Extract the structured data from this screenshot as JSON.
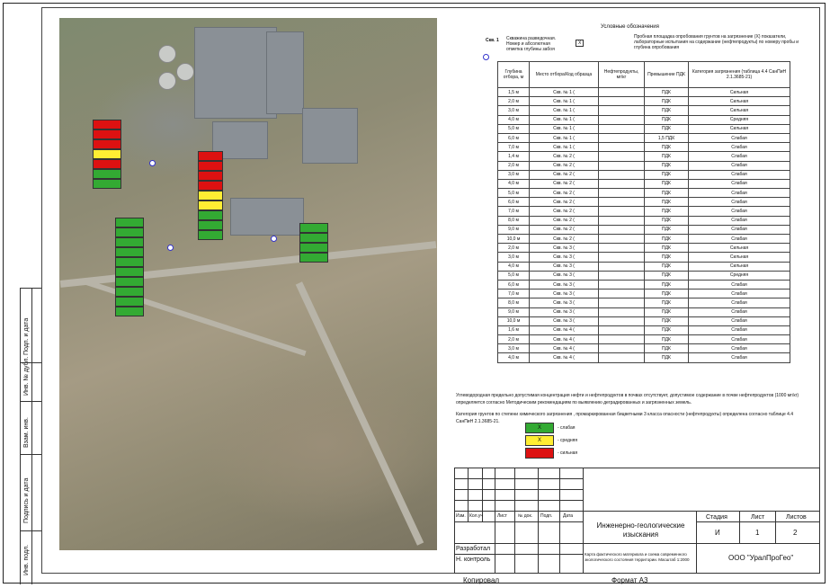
{
  "legend_title": "Условные обозначения",
  "legend_well": {
    "code": "Скв. 1",
    "text": "Скважина разведочная. Номер и абсолютная отметка глубины забоя"
  },
  "legend_sample": {
    "mark": "Х",
    "text": "Пробная площадка опробования грунтов на загрязнение (Х) показатели, лабораторные испытания на содержание (нефтепродукты) по номеру пробы и глубина опробования"
  },
  "table": {
    "headers": [
      "Глубина отбора, м",
      "Место отбора/Код образца",
      "Нефтепродукты, мг/кг",
      "Превышение ПДК",
      "Категория загрязнения (таблица 4.4 СанПиН 2.1.3685-21)"
    ],
    "rows": [
      [
        "1,5 м",
        "Скв. № 1 (",
        "",
        "ПДК",
        "Сильная"
      ],
      [
        "2,0 м",
        "Скв. № 1 (",
        "",
        "ПДК",
        "Сильная"
      ],
      [
        "3,0 м",
        "Скв. № 1 (",
        "",
        "ПДК",
        "Сильная"
      ],
      [
        "4,0 м",
        "Скв. № 1 (",
        "",
        "ПДК",
        "Средняя"
      ],
      [
        "5,0 м",
        "Скв. № 1 (",
        "",
        "ПДК",
        "Сильная"
      ],
      [
        "6,0 м",
        "Скв. № 1 (",
        "",
        "1,5 ПДК",
        "Слабая"
      ],
      [
        "7,0 м",
        "Скв. № 1 (",
        "",
        "ПДК",
        "Слабая"
      ],
      [
        "1,4 м",
        "Скв. № 2 (",
        "",
        "ПДК",
        "Слабая"
      ],
      [
        "2,0 м",
        "Скв. № 2 (",
        "",
        "ПДК",
        "Слабая"
      ],
      [
        "3,0 м",
        "Скв. № 2 (",
        "",
        "ПДК",
        "Слабая"
      ],
      [
        "4,0 м",
        "Скв. № 2 (",
        "",
        "ПДК",
        "Слабая"
      ],
      [
        "5,0 м",
        "Скв. № 2 (",
        "",
        "ПДК",
        "Слабая"
      ],
      [
        "6,0 м",
        "Скв. № 2 (",
        "",
        "ПДК",
        "Слабая"
      ],
      [
        "7,0 м",
        "Скв. № 2 (",
        "",
        "ПДК",
        "Слабая"
      ],
      [
        "8,0 м",
        "Скв. № 2 (",
        "",
        "ПДК",
        "Слабая"
      ],
      [
        "9,0 м",
        "Скв. № 2 (",
        "",
        "ПДК",
        "Слабая"
      ],
      [
        "10,0 м",
        "Скв. № 2 (",
        "",
        "ПДК",
        "Слабая"
      ],
      [
        "2,0 м",
        "Скв. № 3 (",
        "",
        "ПДК",
        "Сильная"
      ],
      [
        "3,0 м",
        "Скв. № 3 (",
        "",
        "ПДК",
        "Сильная"
      ],
      [
        "4,0 м",
        "Скв. № 3 (",
        "",
        "ПДК",
        "Сильная"
      ],
      [
        "5,0 м",
        "Скв. № 3 (",
        "",
        "ПДК",
        "Средняя"
      ],
      [
        "6,0 м",
        "Скв. № 3 (",
        "",
        "ПДК",
        "Слабая"
      ],
      [
        "7,0 м",
        "Скв. № 3 (",
        "",
        "ПДК",
        "Слабая"
      ],
      [
        "8,0 м",
        "Скв. № 3 (",
        "",
        "ПДК",
        "Слабая"
      ],
      [
        "9,0 м",
        "Скв. № 3 (",
        "",
        "ПДК",
        "Слабая"
      ],
      [
        "10,0 м",
        "Скв. № 3 (",
        "",
        "ПДК",
        "Слабая"
      ],
      [
        "1,6 м",
        "Скв. № 4 (",
        "",
        "ПДК",
        "Слабая"
      ],
      [
        "2,0 м",
        "Скв. № 4 (",
        "",
        "ПДК",
        "Слабая"
      ],
      [
        "3,0 м",
        "Скв. № 4 (",
        "",
        "ПДК",
        "Слабая"
      ],
      [
        "4,0 м",
        "Скв. № 4 (",
        "",
        "ПДК",
        "Слабая"
      ]
    ]
  },
  "note_1": "Углеводородная предельно допустимая концентрация нефти и нефтепродуктов в почвах отсутствует, допустимое содержание в почве нефтепродуктов (1000 мг/кг) определяется согласно Методическим рекомендациям по выявлению деградированных и загрязненных земель.",
  "note_2": "Категория грунтов по степени химического загрязнения , промаркированная бицветными 3 класса опасности (нефтепродукты) определена согласно таблице 4.4 СанПиН 2.1.3685-21.",
  "legend_levels": [
    {
      "mark": "Х",
      "color": "#33aa33",
      "label": "- слабая"
    },
    {
      "mark": "Х",
      "color": "#ffee33",
      "label": "- средняя"
    },
    {
      "mark": "",
      "color": "#dd1111",
      "label": "- сильная"
    }
  ],
  "stamp": {
    "col_headers": [
      "Изм.",
      "Кол.уч",
      "Лист",
      "№ док.",
      "Подп.",
      "Дата"
    ],
    "roles": [
      "Разработал",
      "Н. контроль"
    ],
    "project_title": "Инженерно-геологические изыскания",
    "sheet_title": "Карта фактического материала и схема современного экологического состояния территории. Масштаб 1:2000",
    "stage_label": "Стадия",
    "sheet_label": "Лист",
    "sheets_label": "Листов",
    "stage": "И",
    "sheet": "1",
    "sheets": "2",
    "company": "ООО \"УралПроГео\""
  },
  "side_stamp": [
    "Подп. и дата",
    "Инв. № дубл.",
    "Взам. инв.",
    "Подпись и дата",
    "Инв. подл."
  ],
  "footer": {
    "left": "Копировал",
    "right": "Формат А3"
  },
  "colors": {
    "green": "#33aa33",
    "yellow": "#ffee33",
    "red": "#dd1111"
  }
}
